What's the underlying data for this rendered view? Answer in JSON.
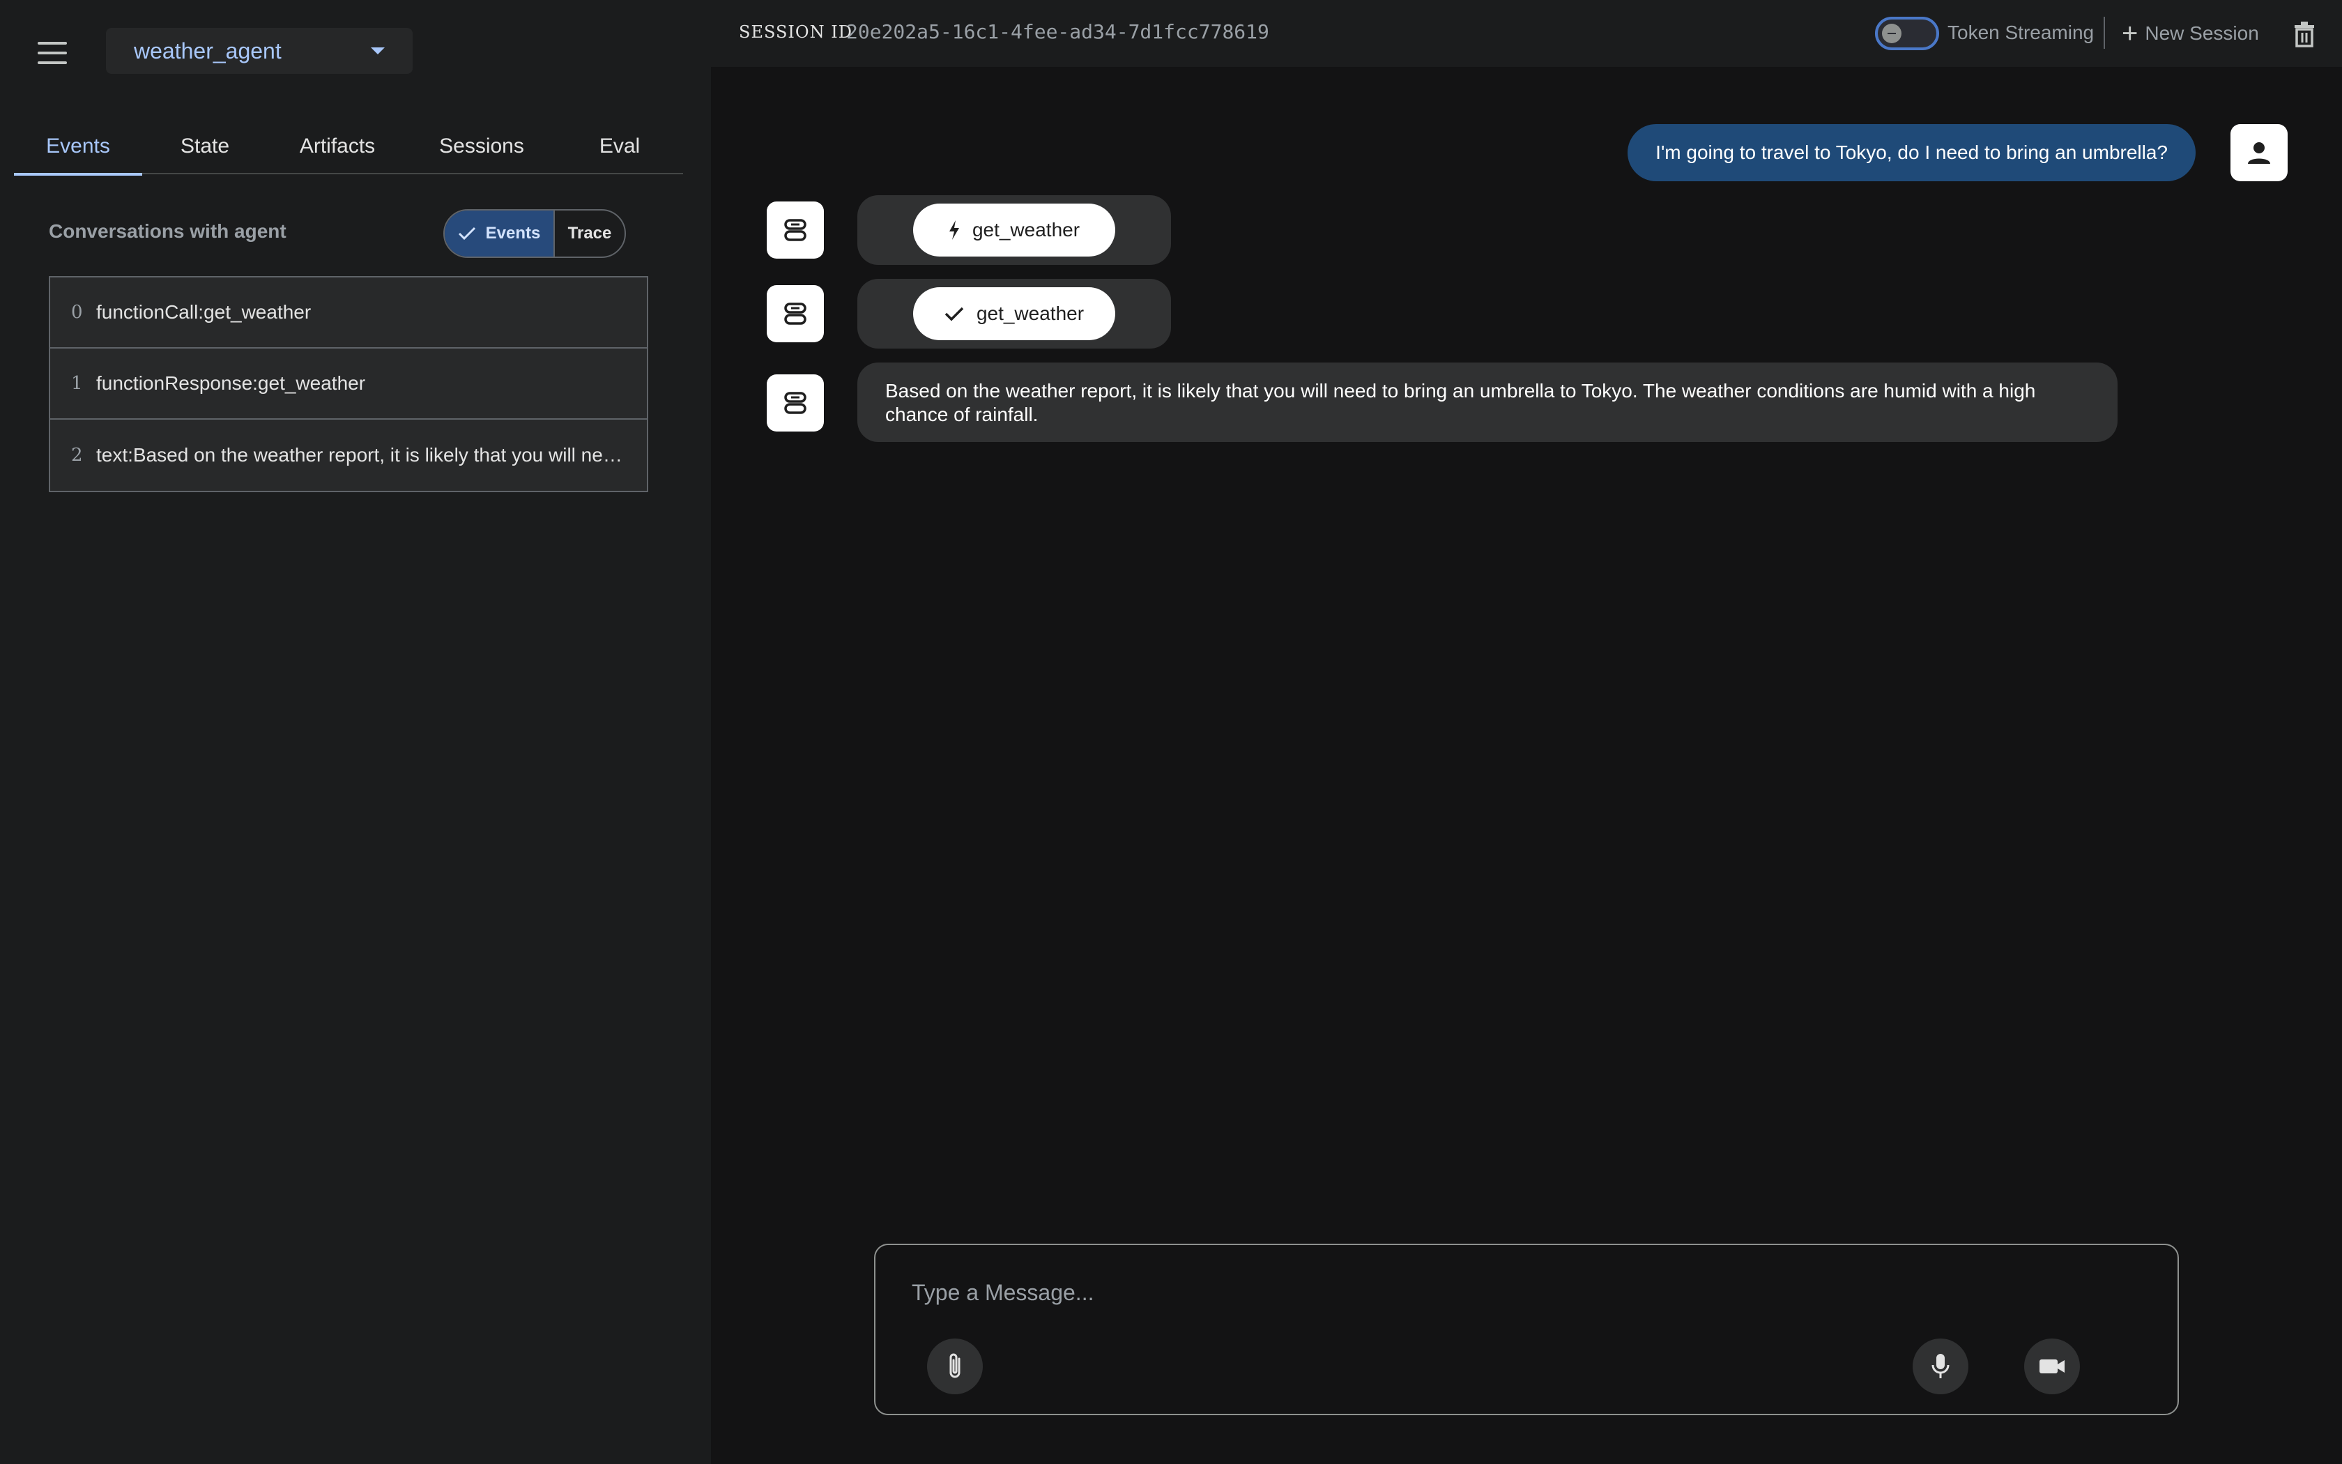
{
  "sidebar": {
    "agent_name": "weather_agent",
    "tabs": [
      {
        "label": "Events"
      },
      {
        "label": "State"
      },
      {
        "label": "Artifacts"
      },
      {
        "label": "Sessions"
      },
      {
        "label": "Eval"
      }
    ],
    "active_tab": "Events",
    "conversation_title": "Conversations with agent",
    "view_toggle": {
      "selected": "Events",
      "options": [
        "Events",
        "Trace"
      ]
    },
    "events": [
      {
        "index": "0",
        "text": "functionCall:get_weather"
      },
      {
        "index": "1",
        "text": "functionResponse:get_weather"
      },
      {
        "index": "2",
        "text": "text:Based on the weather report, it is likely that you will need to bring an umbrella to Tokyo."
      }
    ]
  },
  "header": {
    "session_label": "SESSION ID",
    "session_id": "20e202a5-16c1-4fee-ad34-7d1fcc778619",
    "token_streaming_label": "Token Streaming",
    "token_streaming_on": false,
    "new_session_label": "New Session"
  },
  "chat": {
    "user_message": "I'm going to travel to Tokyo, do I need to bring an umbrella?",
    "function_call": "get_weather",
    "function_response": "get_weather",
    "bot_message": "Based on the weather report, it is likely that you will need to bring an umbrella to Tokyo. The weather conditions are humid with a high chance of rainfall."
  },
  "input": {
    "placeholder": "Type a Message..."
  },
  "icons": {
    "menu": "menu-icon",
    "dropdown": "chevron-down-icon",
    "check": "check-icon",
    "bolt": "bolt-icon",
    "bot": "robot-icon",
    "user": "person-icon",
    "add": "plus-icon",
    "delete": "trash-icon",
    "attach": "paperclip-icon",
    "mic": "microphone-icon",
    "camera": "videocam-icon"
  },
  "colors": {
    "accent": "#a8c7fa",
    "user_bubble": "#1f4a78",
    "background": "#131314",
    "sidebar": "#1b1c1d"
  }
}
